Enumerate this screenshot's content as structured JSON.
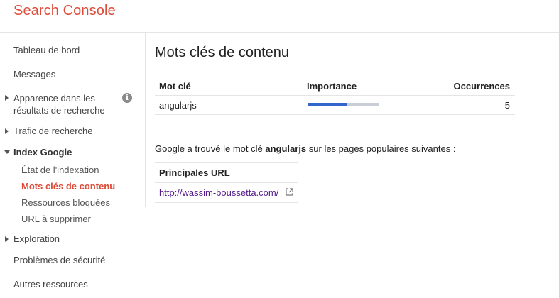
{
  "app": {
    "title": "Search Console"
  },
  "sidebar": {
    "items": [
      {
        "label": "Tableau de bord"
      },
      {
        "label": "Messages"
      },
      {
        "label_line1": "Apparence dans les",
        "label_line2": "résultats de recherche"
      },
      {
        "label": "Trafic de recherche"
      },
      {
        "label": "Index Google"
      },
      {
        "label": "État de l'indexation"
      },
      {
        "label": "Mots clés de contenu"
      },
      {
        "label": "Ressources bloquées"
      },
      {
        "label": "URL à supprimer"
      },
      {
        "label": "Exploration"
      },
      {
        "label": "Problèmes de sécurité"
      },
      {
        "label": "Autres ressources"
      }
    ],
    "info_icon_glyph": "i"
  },
  "main": {
    "title": "Mots clés de contenu",
    "keywords_table": {
      "headers": {
        "keyword": "Mot clé",
        "importance": "Importance",
        "occurrences": "Occurrences"
      },
      "rows": [
        {
          "keyword": "angularjs",
          "importance": 0.55,
          "occurrences": "5"
        }
      ]
    },
    "found_prefix": "Google a trouvé le mot clé ",
    "found_keyword": "angularjs",
    "found_suffix": " sur les pages populaires suivantes :",
    "url_table": {
      "header": "Principales URL",
      "rows": [
        {
          "url": "http://wassim-boussetta.com/"
        }
      ]
    }
  },
  "colors": {
    "brand": "#dd4b39",
    "bar_fill": "#3366cc",
    "bar_bg": "#c8cdd6",
    "link": "#551a8b"
  }
}
